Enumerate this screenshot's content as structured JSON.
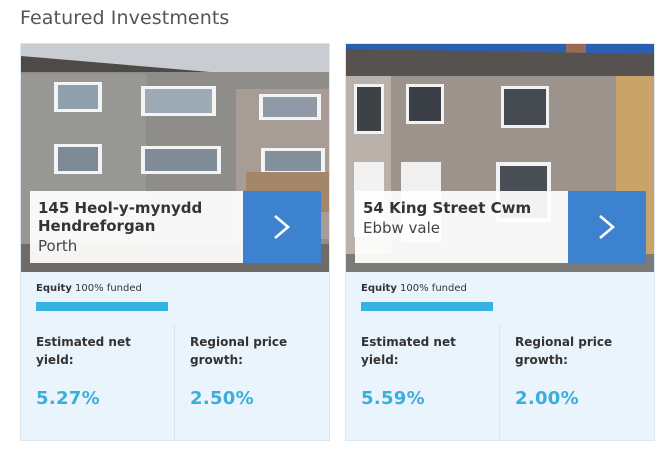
{
  "section": {
    "title": "Featured Investments"
  },
  "colors": {
    "accent_blue": "#3d82cf",
    "progress_blue": "#35b3e2",
    "card_bg": "#eaf4fc",
    "value_blue": "#3aaedc"
  },
  "icons": {
    "go": "chevron-right-icon"
  },
  "cards": [
    {
      "street": "145 Heol-y-mynydd Hendreforgan",
      "town": "Porth",
      "funding": {
        "label": "Equity",
        "text": "100% funded",
        "fraction": 1.0
      },
      "stats": [
        {
          "label": "Estimated net yield:",
          "value": "5.27%"
        },
        {
          "label": "Regional price growth:",
          "value": "2.50%"
        }
      ]
    },
    {
      "street": "54 King Street Cwm",
      "town": "Ebbw vale",
      "funding": {
        "label": "Equity",
        "text": "100% funded",
        "fraction": 1.0
      },
      "stats": [
        {
          "label": "Estimated net yield:",
          "value": "5.59%"
        },
        {
          "label": "Regional price growth:",
          "value": "2.00%"
        }
      ]
    }
  ]
}
